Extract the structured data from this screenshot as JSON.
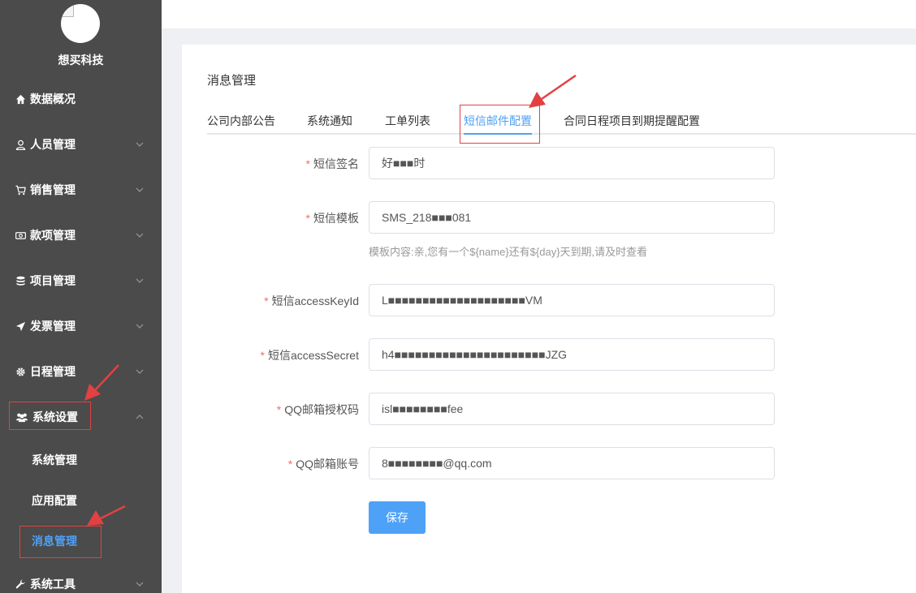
{
  "sidebar": {
    "company_name": "想买科技",
    "menu": [
      {
        "label": "数据概况",
        "icon": "home-icon"
      },
      {
        "label": "人员管理",
        "icon": "user-icon"
      },
      {
        "label": "销售管理",
        "icon": "cart-icon"
      },
      {
        "label": "款项管理",
        "icon": "money-icon"
      },
      {
        "label": "项目管理",
        "icon": "database-icon"
      },
      {
        "label": "发票管理",
        "icon": "send-icon"
      },
      {
        "label": "日程管理",
        "icon": "gear-icon"
      },
      {
        "label": "系统设置",
        "icon": "users-icon"
      },
      {
        "label": "系统工具",
        "icon": "wrench-icon"
      }
    ],
    "submenu": [
      {
        "label": "系统管理"
      },
      {
        "label": "应用配置"
      },
      {
        "label": "消息管理"
      }
    ]
  },
  "page": {
    "title": "消息管理",
    "tabs": [
      {
        "label": "公司内部公告"
      },
      {
        "label": "系统通知"
      },
      {
        "label": "工单列表"
      },
      {
        "label": "短信邮件配置"
      },
      {
        "label": "合同日程项目到期提醒配置"
      }
    ]
  },
  "form": {
    "fields": [
      {
        "label": "短信签名",
        "value": "好■■■时"
      },
      {
        "label": "短信模板",
        "value": "SMS_218■■■081"
      },
      {
        "label": "短信accessKeyId",
        "value": "L■■■■■■■■■■■■■■■■■■■■VM"
      },
      {
        "label": "短信accessSecret",
        "value": "h4■■■■■■■■■■■■■■■■■■■■■■JZG"
      },
      {
        "label": "QQ邮箱授权码",
        "value": "isl■■■■■■■■fee"
      },
      {
        "label": "QQ邮箱账号",
        "value": "8■■■■■■■■@qq.com"
      }
    ],
    "template_hint": "模板内容:亲,您有一个${name}还有${day}天到期,请及时查看",
    "required_mark": "*",
    "save_label": "保存"
  },
  "colors": {
    "sidebar_bg": "#4b4b4b",
    "accent": "#4da1f7",
    "annotation_red": "#e34141"
  }
}
